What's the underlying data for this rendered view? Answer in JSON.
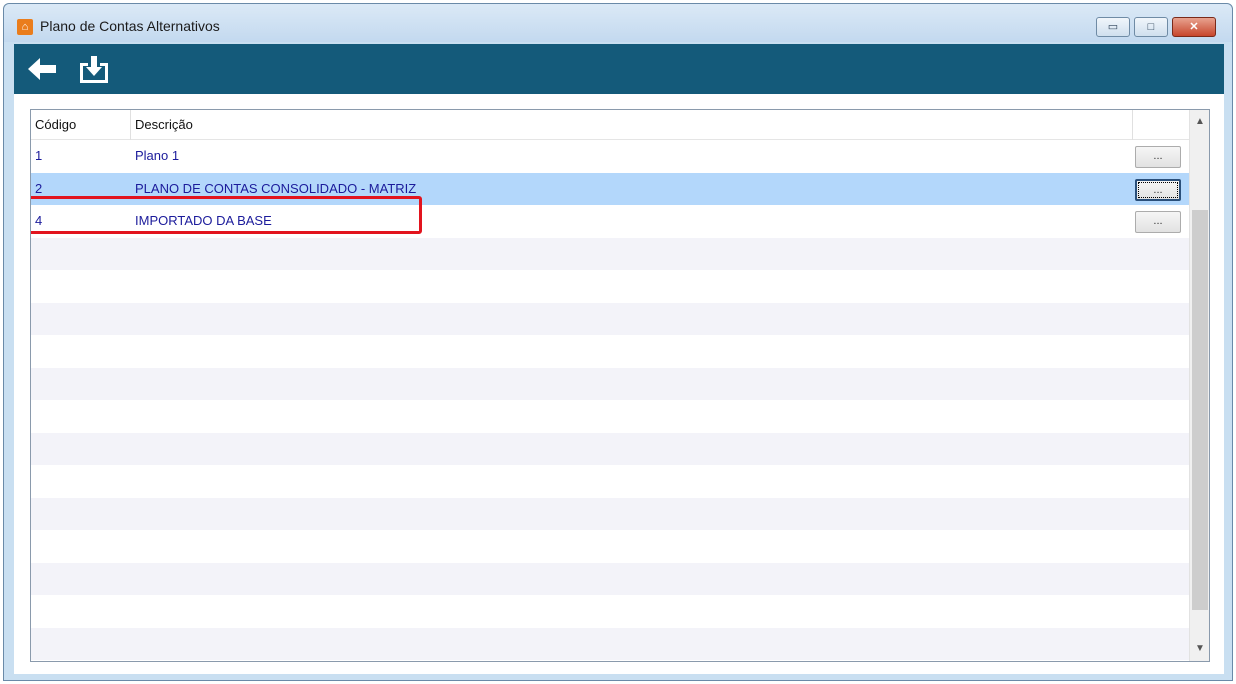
{
  "window": {
    "title": "Plano de Contas Alternativos",
    "minimize_glyph": "▭",
    "maximize_glyph": "□",
    "close_glyph": "✕"
  },
  "toolbar": {
    "back_icon": "arrow-left-icon",
    "export_icon": "download-tray-icon"
  },
  "grid": {
    "columns": [
      "Código",
      "Descrição"
    ],
    "rows": [
      {
        "codigo": "1",
        "descricao": "Plano 1",
        "button": "..."
      },
      {
        "codigo": "2",
        "descricao": "PLANO DE CONTAS CONSOLIDADO - MATRIZ",
        "button": "..."
      },
      {
        "codigo": "4",
        "descricao": "IMPORTADO DA BASE",
        "button": "..."
      }
    ],
    "selected_row": 1
  },
  "colors": {
    "toolbar": "#145a7a",
    "selection": "#b3d7fb",
    "highlight": "#e2141e",
    "row_text": "#1b1b9b"
  }
}
